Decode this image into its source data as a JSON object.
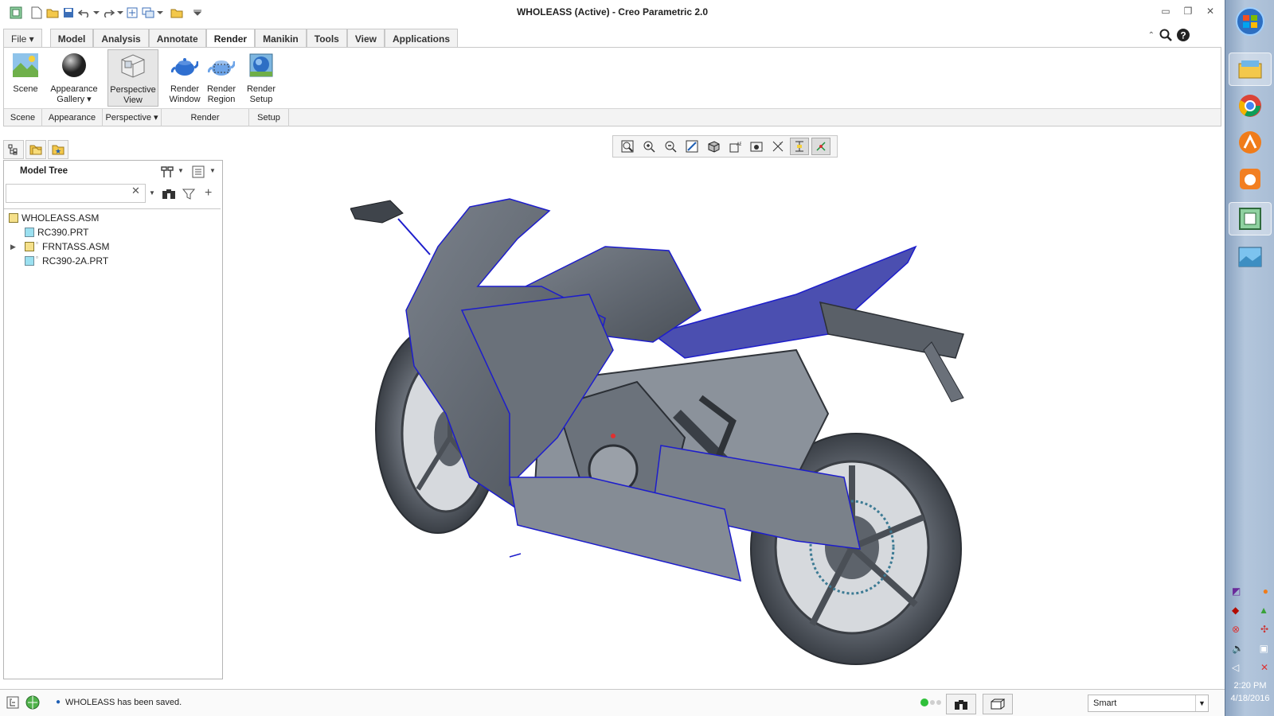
{
  "window": {
    "title": "WHOLEASS (Active) - Creo Parametric 2.0"
  },
  "tabs": [
    {
      "label": "File ▾"
    },
    {
      "label": "Model"
    },
    {
      "label": "Analysis"
    },
    {
      "label": "Annotate"
    },
    {
      "label": "Render"
    },
    {
      "label": "Manikin"
    },
    {
      "label": "Tools"
    },
    {
      "label": "View"
    },
    {
      "label": "Applications"
    }
  ],
  "active_tab": "Render",
  "ribbon": {
    "buttons": [
      {
        "label": "Scene",
        "icon": "scene-icon"
      },
      {
        "label": "Appearance\nGallery ▾",
        "icon": "appearance-gallery-icon"
      },
      {
        "label": "Perspective\nView",
        "icon": "perspective-view-icon",
        "selected": true
      },
      {
        "label": "Render\nWindow",
        "icon": "render-window-icon"
      },
      {
        "label": "Render\nRegion",
        "icon": "render-region-icon"
      },
      {
        "label": "Render\nSetup",
        "icon": "render-setup-icon"
      }
    ],
    "groups": [
      {
        "label": "Scene"
      },
      {
        "label": "Appearance"
      },
      {
        "label": "Perspective ▾"
      },
      {
        "label": "Render"
      },
      {
        "label": "Setup"
      }
    ]
  },
  "model_tree": {
    "title": "Model Tree",
    "search_value": "",
    "items": [
      {
        "label": "WHOLEASS.ASM",
        "kind": "assembly"
      },
      {
        "label": "RC390.PRT",
        "kind": "part"
      },
      {
        "label": "FRNTASS.ASM",
        "kind": "assembly",
        "expandable": true
      },
      {
        "label": "RC390-2A.PRT",
        "kind": "part"
      }
    ]
  },
  "status": {
    "message": "WHOLEASS has been saved.",
    "filter_value": "Smart"
  },
  "taskbar": {
    "time": "2:20 PM",
    "date": "4/18/2016"
  },
  "colors": {
    "accent": "#1f5fb4",
    "model_gray": "#5f6670",
    "edge_blue": "#2020c8"
  }
}
